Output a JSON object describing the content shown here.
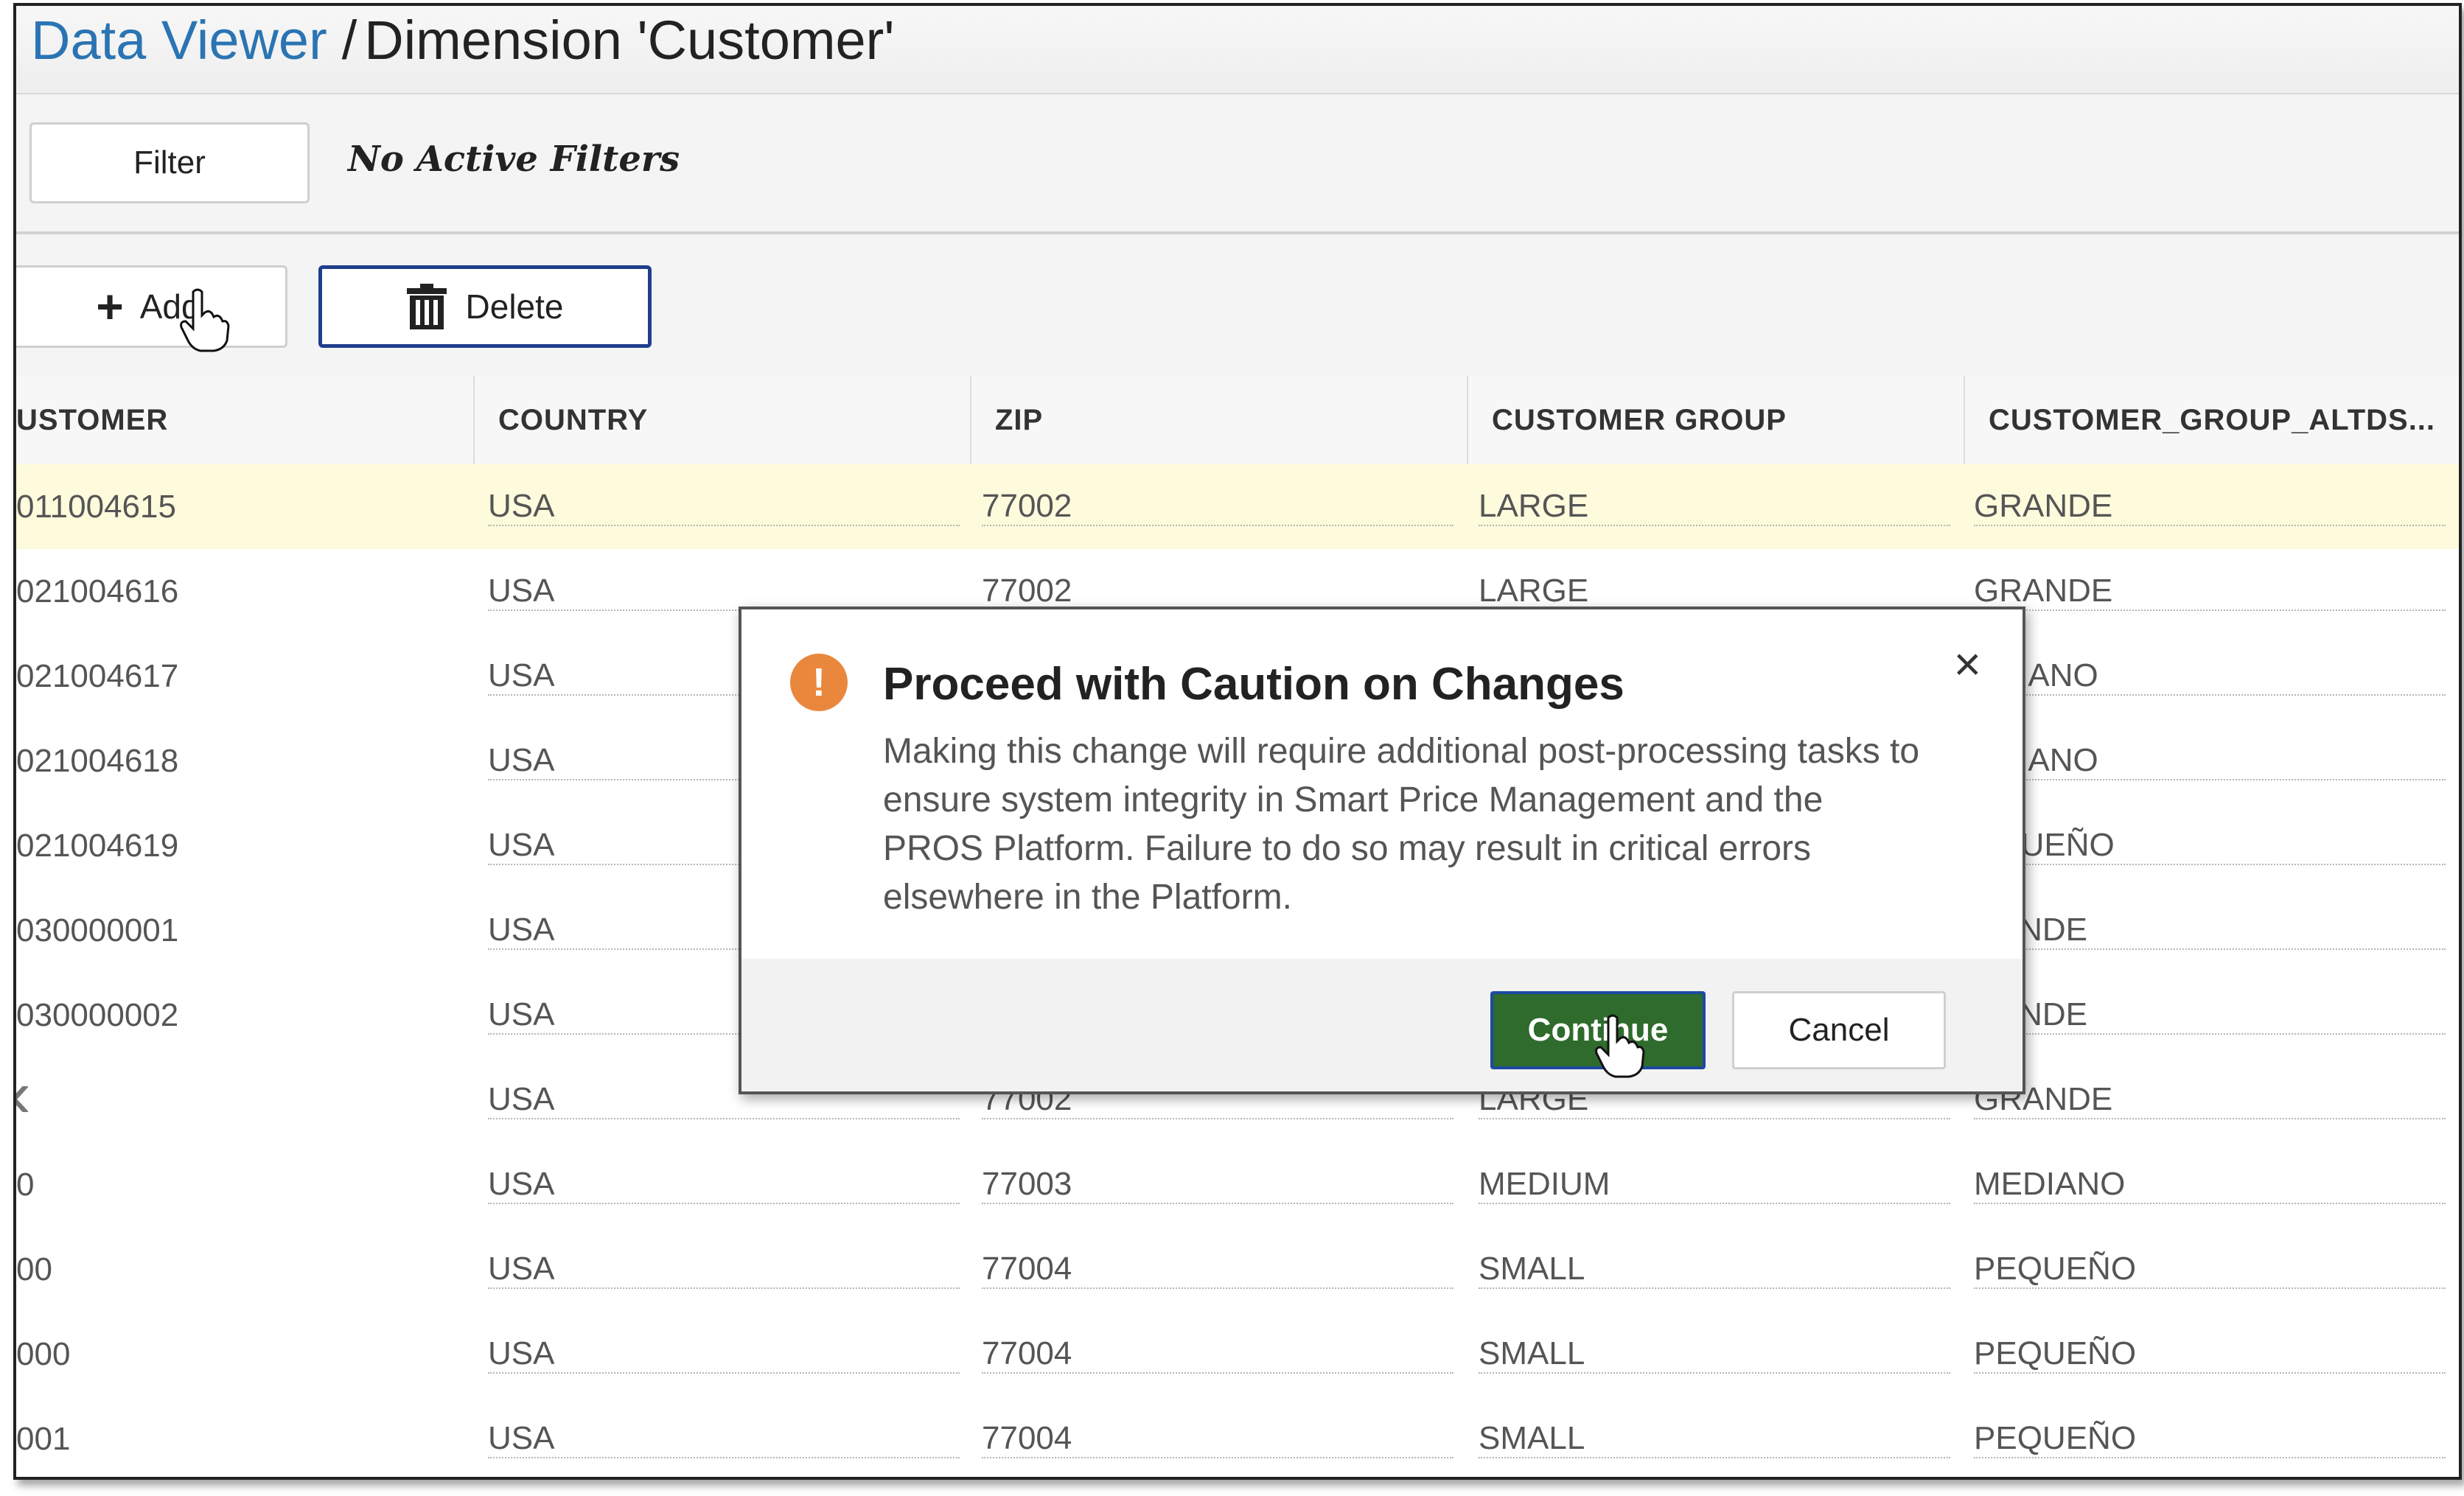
{
  "header": {
    "breadcrumb_link": "Data Viewer",
    "separator": "/",
    "title": "Dimension 'Customer'"
  },
  "filter": {
    "button_label": "Filter",
    "status": "No Active Filters"
  },
  "toolbar": {
    "add_label": "Add",
    "delete_label": "Delete"
  },
  "grid": {
    "columns": [
      "USTOMER",
      "COUNTRY",
      "ZIP",
      "CUSTOMER GROUP",
      "CUSTOMER_GROUP_ALTDS..."
    ],
    "rows": [
      [
        "011004615",
        "USA",
        "77002",
        "LARGE",
        "GRANDE"
      ],
      [
        "021004616",
        "USA",
        "77002",
        "LARGE",
        "GRANDE"
      ],
      [
        "021004617",
        "USA",
        "",
        "",
        "EDIANO"
      ],
      [
        "021004618",
        "USA",
        "",
        "",
        "EDIANO"
      ],
      [
        "021004619",
        "USA",
        "",
        "",
        "EQUEÑO"
      ],
      [
        "030000001",
        "USA",
        "",
        "",
        "RANDE"
      ],
      [
        "030000002",
        "USA",
        "",
        "",
        "RANDE"
      ],
      [
        "",
        "USA",
        "77002",
        "LARGE",
        "GRANDE"
      ],
      [
        "0",
        "USA",
        "77003",
        "MEDIUM",
        "MEDIANO"
      ],
      [
        "00",
        "USA",
        "77004",
        "SMALL",
        "PEQUEÑO"
      ],
      [
        "000",
        "USA",
        "77004",
        "SMALL",
        "PEQUEÑO"
      ],
      [
        "001",
        "USA",
        "77004",
        "SMALL",
        "PEQUEÑO"
      ]
    ]
  },
  "modal": {
    "title": "Proceed with Caution on Changes",
    "icon_text": "!",
    "message": "Making this change will require additional post-processing tasks to ensure system integrity in Smart Price Management and the PROS Platform. Failure to do so may result in critical errors elsewhere in the Platform.",
    "close_glyph": "×",
    "continue_label": "Continue",
    "cancel_label": "Cancel"
  },
  "colors": {
    "link": "#2b74b3",
    "selected_row": "#fdfbdc",
    "warning": "#e9873d",
    "continue_bg": "#2e6b2c",
    "focus_border": "#1f3e8c"
  }
}
